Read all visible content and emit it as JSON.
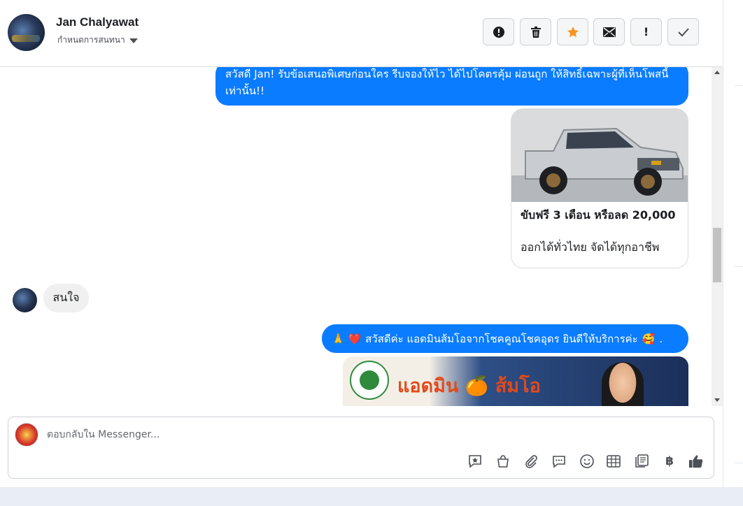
{
  "header": {
    "contact_name": "Jan Chalyawat",
    "status_label": "กำหนดการสนทนา",
    "toolbar": [
      {
        "name": "report-icon",
        "label": ""
      },
      {
        "name": "trash-icon",
        "label": ""
      },
      {
        "name": "star-icon",
        "label": ""
      },
      {
        "name": "mail-icon",
        "label": ""
      },
      {
        "name": "important-icon",
        "label": "!"
      },
      {
        "name": "check-icon",
        "label": ""
      }
    ]
  },
  "messages": {
    "outgoing_1": "สวัสดี Jan! รับข้อเสนอพิเศษก่อนใคร รีบจองให้ไว ได้ไปโคตรคุ้ม ผ่อนถูก ให้สิทธิ์เฉพาะผู้ที่เห็นโพสนี้เท่านั้น!!",
    "card": {
      "title": "ขับฟรี 3 เดือน หรือลด 20,000",
      "subtitle": "ออกได้ทั่วไทย จัดได้ทุกอาชีพ"
    },
    "incoming_1": "สนใจ",
    "outgoing_2": {
      "emoji_before": "🙏 ❤️",
      "text": "สวัสดีค่ะ แอดมินส้มโอจากโชคคูณโชคอุดร ยินดีให้บริการค่ะ",
      "emoji_after": "🥰",
      "trailing": "."
    },
    "banner_text": "แอดมิน 🍊 ส้มโอ"
  },
  "composer": {
    "placeholder": "ตอบกลับใน Messenger...",
    "tools": [
      "star-reply-icon",
      "shopping-bag-icon",
      "paperclip-icon",
      "chat-bubble-icon",
      "emoji-icon",
      "calendar-grid-icon",
      "document-icon",
      "baht-icon",
      "like-icon"
    ]
  },
  "colors": {
    "accent": "#0a7cff",
    "toolbar_star": "#f7931e"
  }
}
